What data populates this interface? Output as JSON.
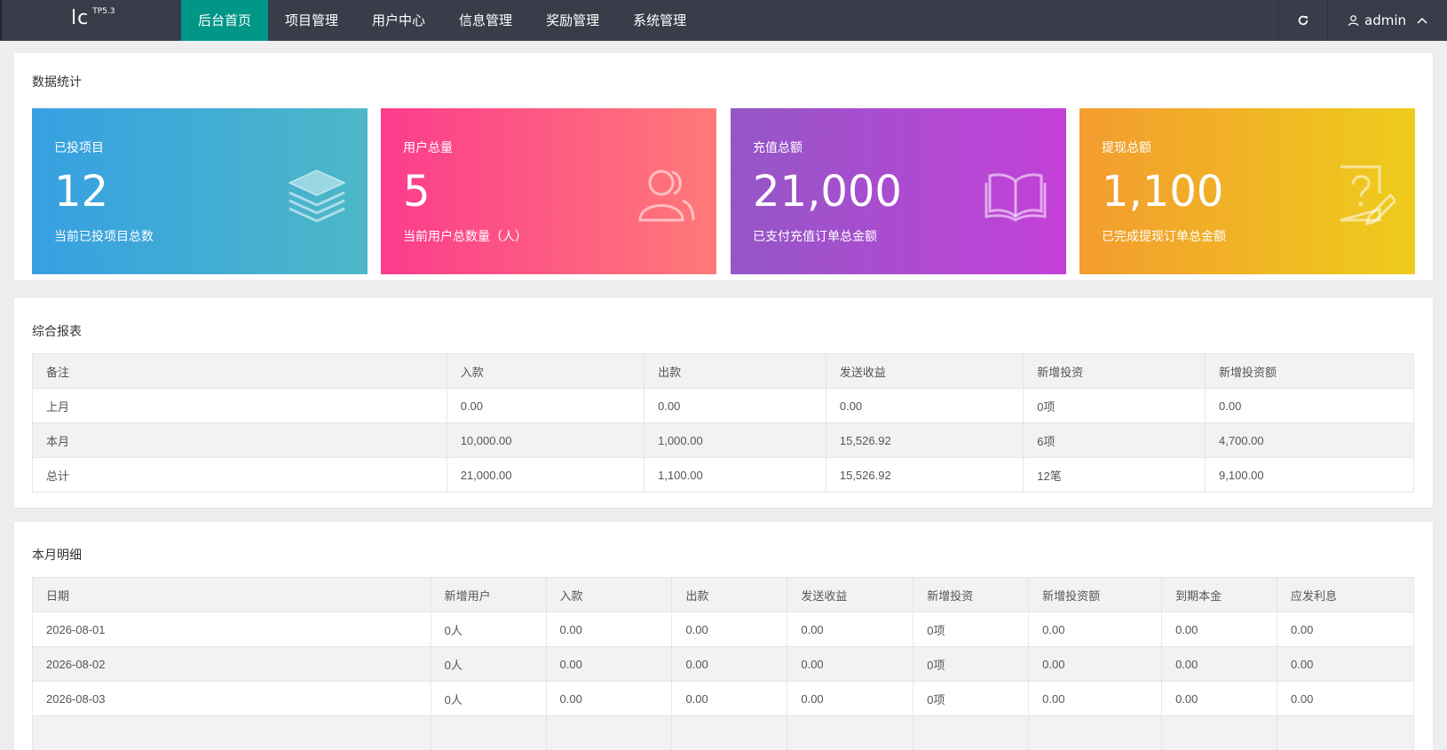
{
  "app": {
    "logo": "lc",
    "logo_sup": "TP5.3"
  },
  "nav": {
    "items": [
      {
        "label": "后台首页",
        "active": true
      },
      {
        "label": "项目管理"
      },
      {
        "label": "用户中心"
      },
      {
        "label": "信息管理"
      },
      {
        "label": "奖励管理"
      },
      {
        "label": "系统管理"
      }
    ],
    "user": "admin",
    "refresh_icon": "refresh-icon",
    "user_icon": "user-icon",
    "caret_icon": "chevron-up-icon"
  },
  "stats": {
    "title": "数据统计",
    "cards": [
      {
        "label": "已投项目",
        "value": "12",
        "desc": "当前已投项目总数",
        "icon": "layers-icon"
      },
      {
        "label": "用户总量",
        "value": "5",
        "desc": "当前用户总数量（人）",
        "icon": "users-icon"
      },
      {
        "label": "充值总额",
        "value": "21,000",
        "desc": "已支付充值订单总金额",
        "icon": "book-icon"
      },
      {
        "label": "提现总额",
        "value": "1,100",
        "desc": "已完成提现订单总金额",
        "icon": "question-edit-icon"
      }
    ]
  },
  "report": {
    "title": "综合报表",
    "headers": [
      "备注",
      "入款",
      "出款",
      "发送收益",
      "新增投资",
      "新增投资额"
    ],
    "rows": [
      [
        "上月",
        "0.00",
        "0.00",
        "0.00",
        "0项",
        "0.00"
      ],
      [
        "本月",
        "10,000.00",
        "1,000.00",
        "15,526.92",
        "6项",
        "4,700.00"
      ],
      [
        "总计",
        "21,000.00",
        "1,100.00",
        "15,526.92",
        "12笔",
        "9,100.00"
      ]
    ]
  },
  "monthly": {
    "title": "本月明细",
    "headers": [
      "日期",
      "新增用户",
      "入款",
      "出款",
      "发送收益",
      "新增投资",
      "新增投资额",
      "到期本金",
      "应发利息"
    ],
    "rows": [
      [
        "2026-08-01",
        "0人",
        "0.00",
        "0.00",
        "0.00",
        "0项",
        "0.00",
        "0.00",
        "0.00"
      ],
      [
        "2026-08-02",
        "0人",
        "0.00",
        "0.00",
        "0.00",
        "0项",
        "0.00",
        "0.00",
        "0.00"
      ],
      [
        "2026-08-03",
        "0人",
        "0.00",
        "0.00",
        "0.00",
        "0项",
        "0.00",
        "0.00",
        "0.00"
      ],
      [
        "",
        "",
        "",
        "",
        "",
        "",
        "",
        "",
        ""
      ]
    ]
  }
}
